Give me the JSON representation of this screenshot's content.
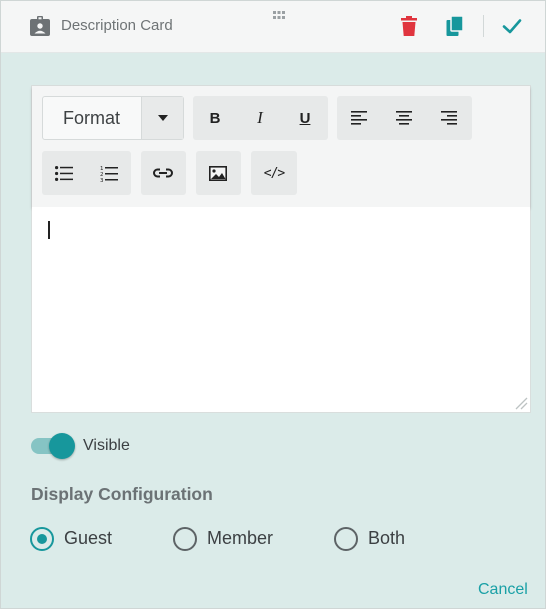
{
  "header": {
    "title": "Description Card",
    "icons": {
      "card": "id-badge-icon",
      "drag": "drag-handle-icon",
      "delete": "trash-icon",
      "copy": "copy-icon",
      "confirm": "check-icon"
    },
    "colors": {
      "delete": "#e0353f",
      "accent": "#17979c"
    }
  },
  "editor": {
    "format_label": "Format",
    "toolbar_buttons": [
      "bold",
      "italic",
      "underline",
      "align-left",
      "align-center",
      "align-right",
      "bullet-list",
      "numbered-list",
      "link",
      "image",
      "code"
    ],
    "bold_label": "B",
    "italic_label": "I",
    "underline_label": "U",
    "code_label": "</>",
    "content": ""
  },
  "visibility": {
    "label": "Visible",
    "enabled": true
  },
  "display_config": {
    "title": "Display Configuration",
    "options": [
      {
        "label": "Guest",
        "checked": true
      },
      {
        "label": "Member",
        "checked": false
      },
      {
        "label": "Both",
        "checked": false
      }
    ]
  },
  "footer": {
    "cancel_label": "Cancel"
  }
}
